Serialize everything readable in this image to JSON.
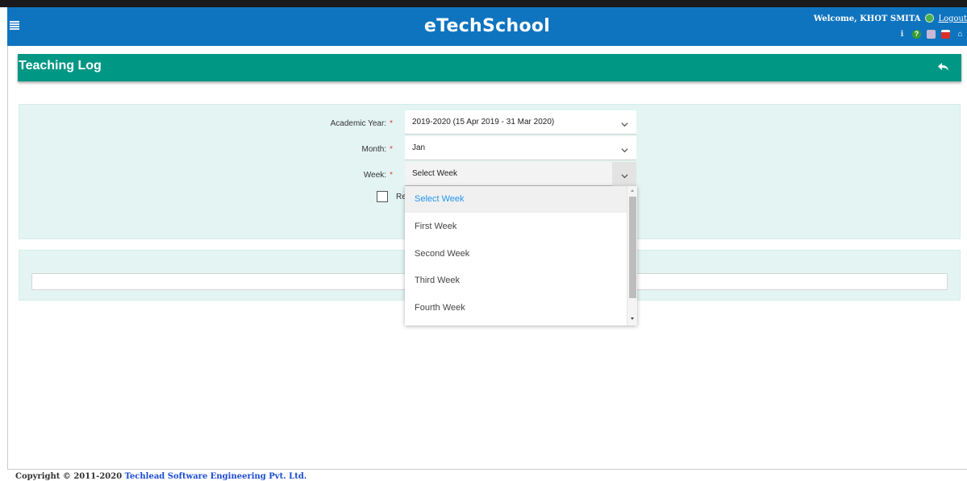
{
  "app": {
    "title": "eTechSchool",
    "welcome": "Welcome, KHOT SMITA",
    "logout": "Logout",
    "header_icons": [
      "info-icon",
      "help-icon",
      "messages-icon",
      "calendar-icon",
      "home-icon"
    ]
  },
  "page": {
    "title": "Teaching Log"
  },
  "form": {
    "academic_year_label": "Academic Year:",
    "academic_year_value": "2019-2020 (15 Apr 2019 - 31 Mar 2020)",
    "month_label": "Month:",
    "month_value": "Jan",
    "week_label": "Week:",
    "week_value": "Select Week",
    "required_mark": "*",
    "checkbox_label_visible": "Re"
  },
  "week_dropdown": {
    "options": [
      "Select Week",
      "First Week",
      "Second Week",
      "Third Week",
      "Fourth Week"
    ],
    "selected": "Select Week"
  },
  "footer": {
    "copyright": "Copyright © 2011-2020 ",
    "company": "Techlead Software Engineering Pvt. Ltd."
  },
  "colors": {
    "topbar": "#0f74bf",
    "headerbar": "#009784",
    "panel": "#e3f4f2",
    "selected_option": "#2196f3",
    "required": "#e53935"
  }
}
